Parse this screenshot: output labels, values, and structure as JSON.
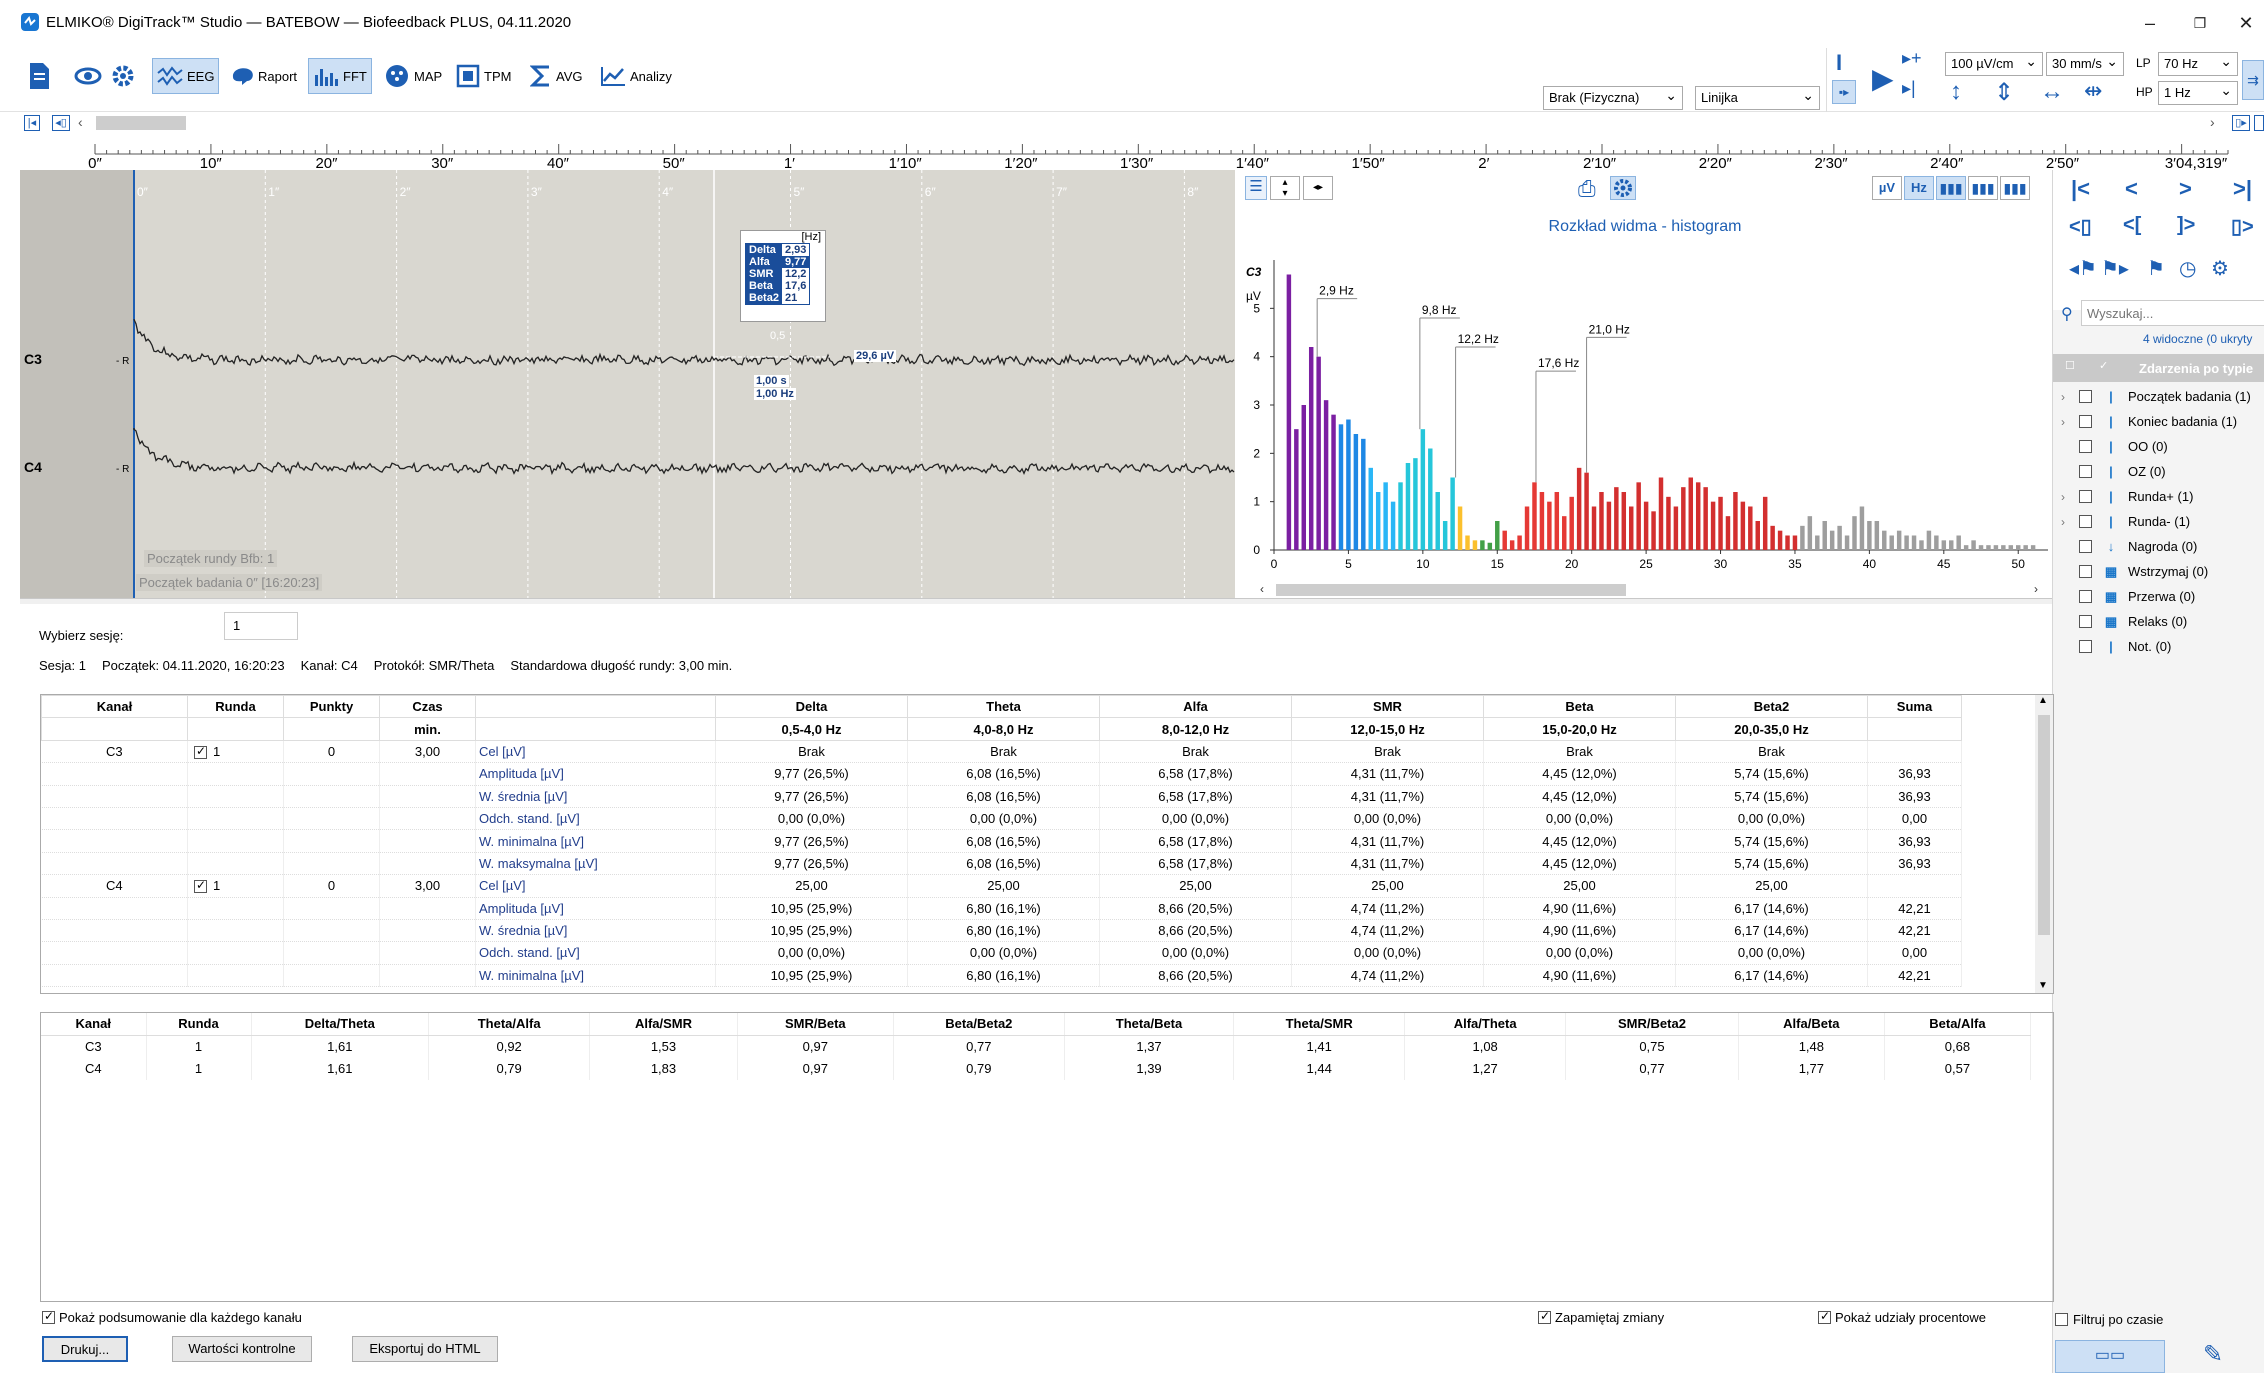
{
  "window": {
    "title": "ELMIKO® DigiTrack™ Studio — BATEBOW — Biofeedback PLUS, 04.11.2020"
  },
  "toolbar": {
    "eeg": "EEG",
    "raport": "Raport",
    "fft": "FFT",
    "map": "MAP",
    "tpm": "TPM",
    "avg": "AVG",
    "analizy": "Analizy",
    "sensitivity": "100 µV/cm",
    "speed": "30 mm/s",
    "lp_label": "LP",
    "lp_value": "70 Hz",
    "hp_label": "HP",
    "hp_value": "1 Hz",
    "montage": "Brak (Fizyczna)",
    "ruler": "Linijka"
  },
  "timeline": {
    "ticks": [
      "0″",
      "10″",
      "20″",
      "30″",
      "40″",
      "50″",
      "1′",
      "1′10″",
      "1′20″",
      "1′30″",
      "1′40″",
      "1′50″",
      "2′",
      "2′10″",
      "2′20″",
      "2′30″",
      "2′40″",
      "2′50″",
      "3′04,319″"
    ]
  },
  "eeg": {
    "seconds": [
      "0″",
      "1″",
      "2″",
      "3″",
      "4″",
      "5″",
      "6″",
      "7″",
      "8″"
    ],
    "channels": [
      "C3",
      "C4"
    ],
    "ref": "- R",
    "popup": {
      "unit": "[Hz]",
      "rows": [
        [
          "Delta",
          "2,93"
        ],
        [
          "Alfa",
          "9,77"
        ],
        [
          "SMR",
          "12,2"
        ],
        [
          "Beta",
          "17,6"
        ],
        [
          "Beta2",
          "21"
        ]
      ]
    },
    "marker_value": "0,5",
    "amplitude": "29,6 µV",
    "dur1": "1,00 s",
    "dur2": "1,00 Hz",
    "event1": "Początek rundy Bfb: 1",
    "event2": "Początek badania 0″ [16:20:23]"
  },
  "histogram": {
    "title": "Rozkład widma - histogram",
    "channel": "C3",
    "yunit": "µV",
    "units_uv": "µV",
    "units_hz": "Hz",
    "annotations": [
      "2,9 Hz",
      "9,8 Hz",
      "12,2 Hz",
      "17,6 Hz",
      "21,0 Hz"
    ],
    "yticks": [
      "0",
      "1",
      "2",
      "3",
      "4",
      "5"
    ],
    "xticks": [
      "0",
      "5",
      "10",
      "15",
      "20",
      "25",
      "30",
      "35",
      "40",
      "45",
      "50"
    ]
  },
  "chart_data": {
    "type": "bar",
    "title": "Rozkład widma - histogram",
    "xlabel": "",
    "ylabel": "µV",
    "xlim": [
      0,
      52
    ],
    "ylim": [
      0,
      6
    ],
    "x": [
      1,
      1.5,
      2,
      2.5,
      3,
      3.5,
      4,
      4.5,
      5,
      5.5,
      6,
      6.5,
      7,
      7.5,
      8,
      8.5,
      9,
      9.5,
      10,
      10.5,
      11,
      11.5,
      12,
      12.5,
      13,
      13.5,
      14,
      14.5,
      15,
      15.5,
      16,
      16.5,
      17,
      17.5,
      18,
      18.5,
      19,
      19.5,
      20,
      20.5,
      21,
      21.5,
      22,
      22.5,
      23,
      23.5,
      24,
      24.5,
      25,
      25.5,
      26,
      26.5,
      27,
      27.5,
      28,
      28.5,
      29,
      29.5,
      30,
      30.5,
      31,
      31.5,
      32,
      32.5,
      33,
      33.5,
      34,
      34.5,
      35,
      35.5,
      36,
      36.5,
      37,
      37.5,
      38,
      38.5,
      39,
      39.5,
      40,
      40.5,
      41,
      41.5,
      42,
      42.5,
      43,
      43.5,
      44,
      44.5,
      45,
      45.5,
      46,
      46.5,
      47,
      47.5,
      48,
      48.5,
      49,
      49.5,
      50,
      50.5,
      51
    ],
    "values": [
      5.7,
      2.5,
      3.0,
      4.2,
      4.0,
      3.1,
      2.8,
      2.6,
      2.7,
      2.4,
      2.3,
      1.7,
      1.2,
      1.4,
      1.0,
      1.4,
      1.8,
      1.9,
      2.5,
      2.1,
      1.2,
      0.6,
      1.5,
      0.9,
      0.3,
      0.2,
      0.2,
      0.15,
      0.6,
      0.4,
      0.2,
      0.3,
      0.9,
      1.4,
      1.2,
      1.0,
      1.2,
      0.7,
      1.1,
      1.7,
      1.6,
      0.9,
      1.2,
      1.0,
      1.3,
      1.2,
      0.9,
      1.4,
      1.0,
      0.8,
      1.5,
      1.1,
      0.9,
      1.3,
      1.5,
      1.4,
      1.3,
      1.0,
      1.1,
      0.7,
      1.2,
      1.0,
      0.9,
      0.6,
      1.1,
      0.5,
      0.4,
      0.3,
      0.3,
      0.5,
      0.7,
      0.3,
      0.6,
      0.4,
      0.5,
      0.3,
      0.7,
      0.9,
      0.6,
      0.6,
      0.4,
      0.3,
      0.4,
      0.3,
      0.3,
      0.2,
      0.4,
      0.3,
      0.2,
      0.2,
      0.3,
      0.1,
      0.2,
      0.1,
      0.1,
      0.1,
      0.1,
      0.1,
      0.1,
      0.1,
      0.1
    ],
    "band_colors": {
      "delta": "#7b1fa2",
      "theta": "#1e88e5",
      "alfa": "#26c6da",
      "smr": "#43a047",
      "beta": "#fbc02d",
      "beta2": "#d32f2f",
      "rest": "#9e9e9e"
    }
  },
  "session": {
    "select_label": "Wybierz sesję:",
    "select_value": "1",
    "info": [
      "Sesja: 1",
      "Początek: 04.11.2020, 16:20:23",
      "Kanał: C4",
      "Protokół: SMR/Theta",
      "Standardowa długość rundy: 3,00 min."
    ]
  },
  "table1": {
    "headers": [
      "Kanał",
      "Runda",
      "Punkty",
      "Czas",
      "",
      "Delta",
      "Theta",
      "Alfa",
      "SMR",
      "Beta",
      "Beta2",
      "Suma"
    ],
    "subheaders": [
      "",
      "",
      "",
      "min.",
      "",
      "0,5-4,0 Hz",
      "4,0-8,0 Hz",
      "8,0-12,0 Hz",
      "12,0-15,0 Hz",
      "15,0-20,0 Hz",
      "20,0-35,0 Hz",
      ""
    ],
    "rows": [
      [
        "C3",
        "1",
        "0",
        "3,00",
        "Cel [µV]",
        "Brak",
        "Brak",
        "Brak",
        "Brak",
        "Brak",
        "Brak",
        ""
      ],
      [
        "",
        "",
        "",
        "",
        "Amplituda [µV]",
        "9,77 (26,5%)",
        "6,08 (16,5%)",
        "6,58 (17,8%)",
        "4,31 (11,7%)",
        "4,45 (12,0%)",
        "5,74 (15,6%)",
        "36,93"
      ],
      [
        "",
        "",
        "",
        "",
        "W. średnia [µV]",
        "9,77 (26,5%)",
        "6,08 (16,5%)",
        "6,58 (17,8%)",
        "4,31 (11,7%)",
        "4,45 (12,0%)",
        "5,74 (15,6%)",
        "36,93"
      ],
      [
        "",
        "",
        "",
        "",
        "Odch. stand. [µV]",
        "0,00 (0,0%)",
        "0,00 (0,0%)",
        "0,00 (0,0%)",
        "0,00 (0,0%)",
        "0,00 (0,0%)",
        "0,00 (0,0%)",
        "0,00"
      ],
      [
        "",
        "",
        "",
        "",
        "W. minimalna [µV]",
        "9,77 (26,5%)",
        "6,08 (16,5%)",
        "6,58 (17,8%)",
        "4,31 (11,7%)",
        "4,45 (12,0%)",
        "5,74 (15,6%)",
        "36,93"
      ],
      [
        "",
        "",
        "",
        "",
        "W. maksymalna [µV]",
        "9,77 (26,5%)",
        "6,08 (16,5%)",
        "6,58 (17,8%)",
        "4,31 (11,7%)",
        "4,45 (12,0%)",
        "5,74 (15,6%)",
        "36,93"
      ],
      [
        "C4",
        "1",
        "0",
        "3,00",
        "Cel [µV]",
        "25,00",
        "25,00",
        "25,00",
        "25,00",
        "25,00",
        "25,00",
        ""
      ],
      [
        "",
        "",
        "",
        "",
        "Amplituda [µV]",
        "10,95 (25,9%)",
        "6,80 (16,1%)",
        "8,66 (20,5%)",
        "4,74 (11,2%)",
        "4,90 (11,6%)",
        "6,17 (14,6%)",
        "42,21"
      ],
      [
        "",
        "",
        "",
        "",
        "W. średnia [µV]",
        "10,95 (25,9%)",
        "6,80 (16,1%)",
        "8,66 (20,5%)",
        "4,74 (11,2%)",
        "4,90 (11,6%)",
        "6,17 (14,6%)",
        "42,21"
      ],
      [
        "",
        "",
        "",
        "",
        "Odch. stand. [µV]",
        "0,00 (0,0%)",
        "0,00 (0,0%)",
        "0,00 (0,0%)",
        "0,00 (0,0%)",
        "0,00 (0,0%)",
        "0,00 (0,0%)",
        "0,00"
      ],
      [
        "",
        "",
        "",
        "",
        "W. minimalna [µV]",
        "10,95 (25,9%)",
        "6,80 (16,1%)",
        "8,66 (20,5%)",
        "4,74 (11,2%)",
        "4,90 (11,6%)",
        "6,17 (14,6%)",
        "42,21"
      ]
    ]
  },
  "table2": {
    "headers": [
      "Kanał",
      "Runda",
      "Delta/Theta",
      "Theta/Alfa",
      "Alfa/SMR",
      "SMR/Beta",
      "Beta/Beta2",
      "Theta/Beta",
      "Theta/SMR",
      "Alfa/Theta",
      "SMR/Beta2",
      "Alfa/Beta",
      "Beta/Alfa"
    ],
    "rows": [
      [
        "C3",
        "1",
        "1,61",
        "0,92",
        "1,53",
        "0,97",
        "0,77",
        "1,37",
        "1,41",
        "1,08",
        "0,75",
        "1,48",
        "0,68"
      ],
      [
        "C4",
        "1",
        "1,61",
        "0,79",
        "1,83",
        "0,97",
        "0,79",
        "1,39",
        "1,44",
        "1,27",
        "0,77",
        "1,77",
        "0,57"
      ]
    ]
  },
  "footer": {
    "show_summary": "Pokaż podsumowanie dla każdego kanału",
    "remember": "Zapamiętaj zmiany",
    "show_shares": "Pokaż udziały procentowe",
    "print": "Drukuj...",
    "control_values": "Wartości kontrolne",
    "export_html": "Eksportuj do HTML"
  },
  "events": {
    "search_placeholder": "Wyszukaj...",
    "visible": "4 widoczne (0 ukryty",
    "header": "Zdarzenia po typie",
    "items": [
      {
        "label": "Początek badania (1)",
        "icon": "bar-marker-icon",
        "expand": true
      },
      {
        "label": "Koniec badania (1)",
        "icon": "bar-marker-icon",
        "expand": true
      },
      {
        "label": "OO (0)",
        "icon": "bar-marker-icon",
        "expand": false
      },
      {
        "label": "OZ (0)",
        "icon": "bar-marker-icon",
        "expand": false
      },
      {
        "label": "Runda+ (1)",
        "icon": "bar-marker-icon",
        "expand": true
      },
      {
        "label": "Runda- (1)",
        "icon": "bar-marker-icon",
        "expand": true
      },
      {
        "label": "Nagroda (0)",
        "icon": "arrow-down-icon",
        "expand": false
      },
      {
        "label": "Wstrzymaj (0)",
        "icon": "checker-icon",
        "expand": false
      },
      {
        "label": "Przerwa (0)",
        "icon": "checker-icon",
        "expand": false
      },
      {
        "label": "Relaks (0)",
        "icon": "checker-icon",
        "expand": false
      },
      {
        "label": "Not. (0)",
        "icon": "bar-marker-icon",
        "expand": false
      }
    ],
    "filter": "Filtruj po czasie"
  }
}
